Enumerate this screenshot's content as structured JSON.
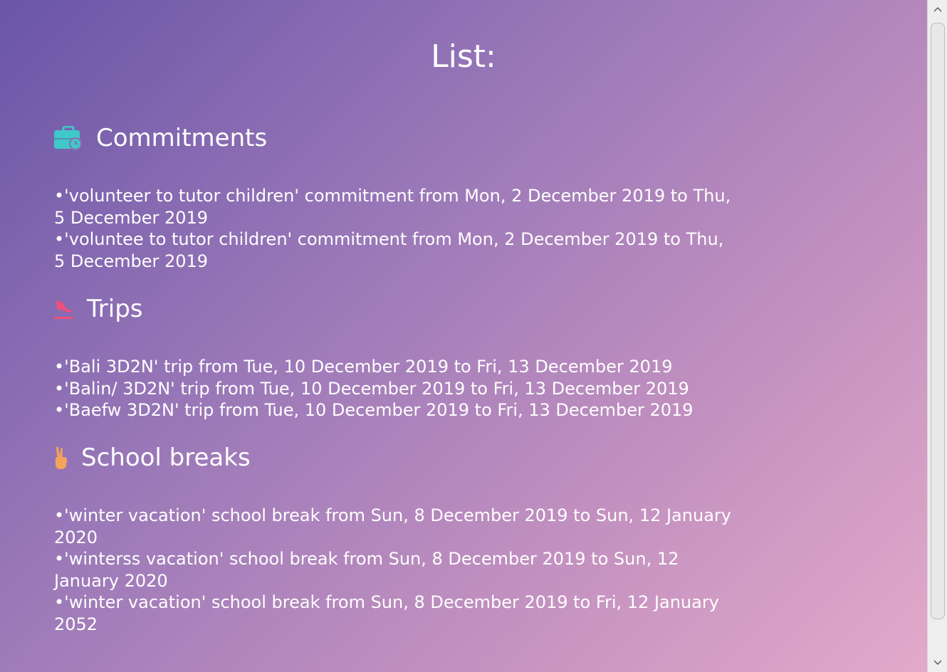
{
  "header": {
    "title": "List:"
  },
  "sections": [
    {
      "icon": "briefcase-clock-icon",
      "title": "Commitments",
      "items": [
        "•'volunteer to tutor children' commitment from Mon, 2 December 2019 to Thu, 5 December 2019",
        "•'voluntee to tutor children' commitment from Mon, 2 December 2019 to Thu, 5 December 2019"
      ]
    },
    {
      "icon": "plane-landing-icon",
      "title": "Trips",
      "items": [
        "•'Bali 3D2N' trip from Tue, 10 December 2019 to Fri, 13 December 2019",
        "•'Balin/ 3D2N' trip from Tue, 10 December 2019 to Fri, 13 December 2019",
        "•'Baefw 3D2N' trip from Tue, 10 December 2019 to Fri, 13 December 2019"
      ]
    },
    {
      "icon": "victory-hand-icon",
      "title": "School breaks",
      "items": [
        "•'winter vacation' school break from Sun, 8 December 2019 to Sun, 12 January 2020",
        "•'winterss vacation' school break from Sun, 8 December 2019 to Sun, 12 January 2020",
        "•'winter vacation' school break from Sun, 8 December 2019 to Fri, 12 January 2052"
      ]
    }
  ],
  "colors": {
    "commitments_icon": "#3ec8c8",
    "trips_icon": "#f0507a",
    "school_breaks_icon": "#f5a35a"
  }
}
